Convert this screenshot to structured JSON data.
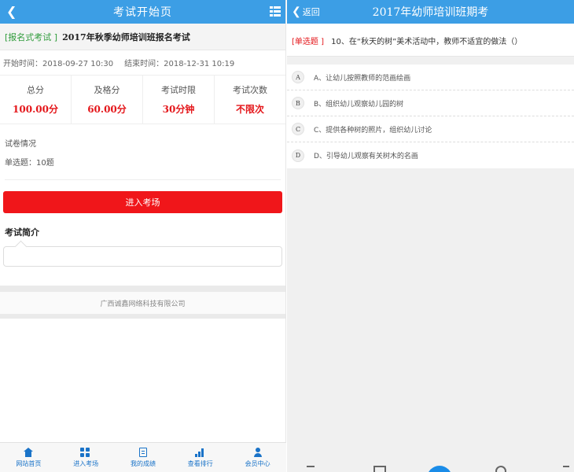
{
  "left": {
    "topbar": {
      "title": "考试开始页"
    },
    "exam": {
      "tag": "[报名式考试 ]",
      "name": "2017年秋季幼师培训班报名考试"
    },
    "times": {
      "start": "开始时间：2018-09-27 10:30",
      "end": "结束时间：2018-12-31 10:19"
    },
    "stats": [
      {
        "label": "总分",
        "value": "100.00分"
      },
      {
        "label": "及格分",
        "value": "60.00分"
      },
      {
        "label": "考试时限",
        "value": "30分钟"
      },
      {
        "label": "考试次数",
        "value": "不限次"
      }
    ],
    "paper": {
      "title": "试卷情况",
      "detail": "单选题：10题"
    },
    "enter_button": "进入考场",
    "intro": {
      "title": "考试简介"
    },
    "company": "广西诚鑫网络科技有限公司",
    "nav": [
      {
        "label": "网站首页",
        "icon": "home-icon"
      },
      {
        "label": "进入考场",
        "icon": "grid-icon"
      },
      {
        "label": "我的成绩",
        "icon": "document-icon"
      },
      {
        "label": "查看排行",
        "icon": "bar-chart-icon"
      },
      {
        "label": "会员中心",
        "icon": "user-icon"
      }
    ],
    "colors": {
      "header": "#3c9ee5",
      "accent_red": "#e4161a",
      "nav_blue": "#1a73c8"
    }
  },
  "right": {
    "topbar": {
      "back_label": "返回",
      "title": "2017年幼师培训班期考"
    },
    "question": {
      "type": "[单选题 ]",
      "text": "10、在“秋天的树”美术活动中，教师不适宜的做法（）"
    },
    "options": [
      {
        "letter": "A",
        "text": "A、让幼儿按照教师的范画绘画"
      },
      {
        "letter": "B",
        "text": "B、组织幼儿观察幼儿园的树"
      },
      {
        "letter": "C",
        "text": "C、提供各种树的照片，组织幼儿讨论"
      },
      {
        "letter": "D",
        "text": "D、引导幼儿观察有关树木的名画"
      }
    ]
  }
}
